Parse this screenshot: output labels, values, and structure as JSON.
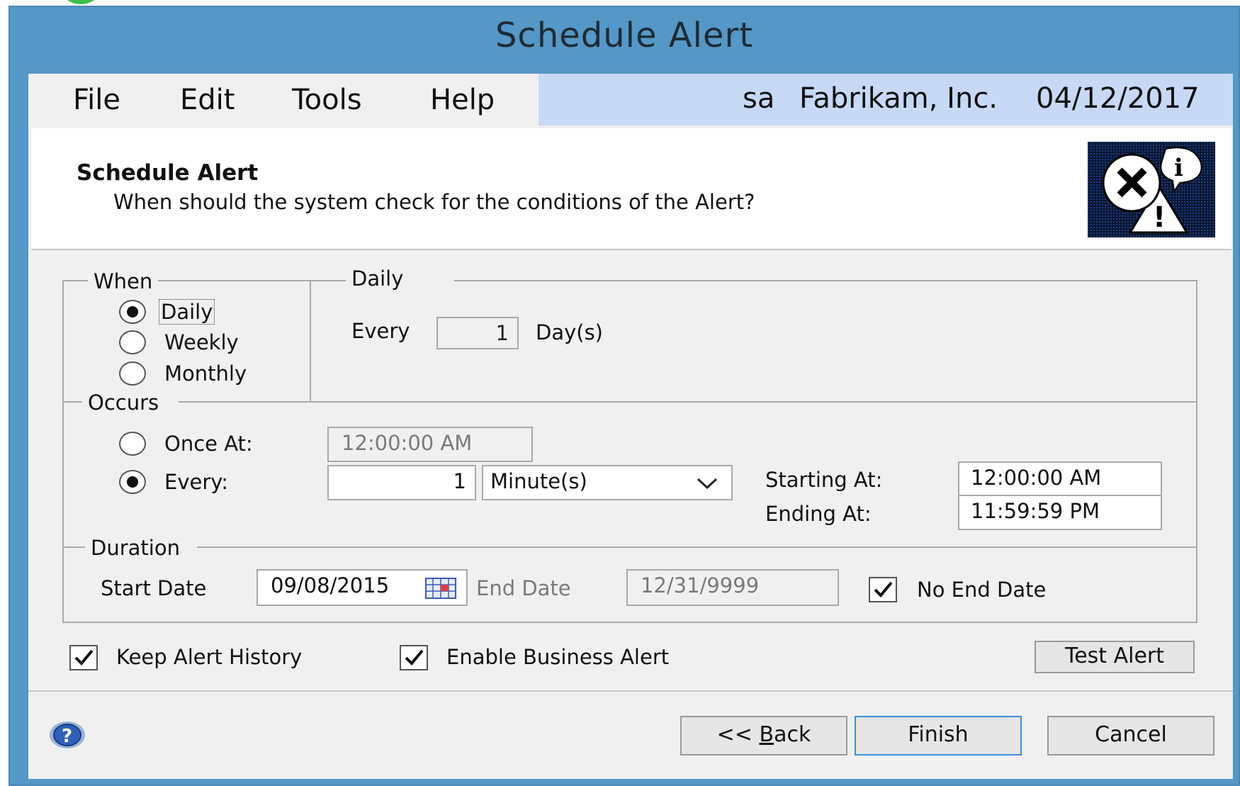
{
  "window": {
    "title": "Schedule Alert"
  },
  "menu": {
    "file": "File",
    "edit": "Edit",
    "tools": "Tools",
    "help": "Help"
  },
  "status": {
    "user": "sa",
    "company": "Fabrikam, Inc.",
    "date": "04/12/2017"
  },
  "header": {
    "title": "Schedule Alert",
    "subtitle": "When should the system check for the conditions of the Alert?",
    "icon": "alert-icons"
  },
  "when": {
    "legend": "When",
    "options": [
      "Daily",
      "Weekly",
      "Monthly"
    ],
    "selected": "Daily"
  },
  "daily": {
    "legend": "Daily",
    "every_label": "Every",
    "every_value": "1",
    "unit_label": "Day(s)"
  },
  "occurs": {
    "legend": "Occurs",
    "once_label": "Once At:",
    "once_value": "12:00:00 AM",
    "every_label": "Every:",
    "every_value": "1",
    "every_unit": "Minute(s)",
    "selected": "Every",
    "starting_label": "Starting At:",
    "starting_value": "12:00:00 AM",
    "ending_label": "Ending At:",
    "ending_value": "11:59:59 PM"
  },
  "duration": {
    "legend": "Duration",
    "start_label": "Start Date",
    "start_value": "09/08/2015",
    "end_label": "End Date",
    "end_value": "12/31/9999",
    "no_end_label": "No End Date",
    "no_end_checked": true
  },
  "options": {
    "keep_history_label": "Keep Alert History",
    "keep_history_checked": true,
    "enable_label": "Enable Business Alert",
    "enable_checked": true,
    "test_button": "Test Alert"
  },
  "footer": {
    "help_icon": "help-icon",
    "back_prefix": "<< ",
    "back_underlined": "B",
    "back_rest": "ack",
    "finish": "Finish",
    "cancel": "Cancel"
  },
  "colors": {
    "frame": "#5597c6",
    "client": "#f0f0f0",
    "status_bar": "#c7d9f5",
    "accent_border": "#3d8fe0"
  }
}
